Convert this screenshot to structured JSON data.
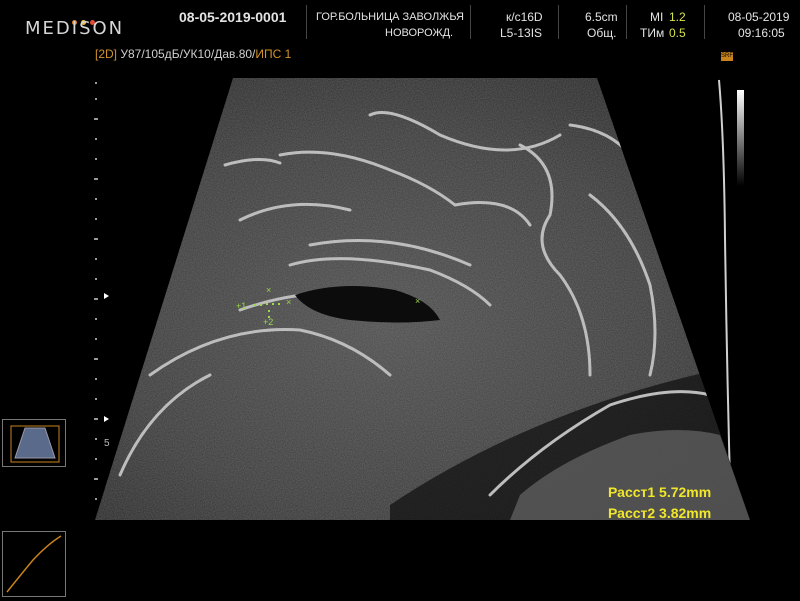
{
  "header": {
    "brand": "MEDISON",
    "brand_dot_colors": [
      "#e0852a",
      "#e8c23a",
      "#e04a3a"
    ],
    "patient_id": "08-05-2019-0001",
    "hospital": "ГОР.БОЛЬНИЦА ЗАВОЛЖЬЯ",
    "department": "НОВОРОЖД.",
    "probe_preset": "к/с16D",
    "probe": "L5-13IS",
    "depth": "6.5cm",
    "preset_mode": "Общ.",
    "mi_label": "MI",
    "mi_value": "1.2",
    "tim_label": "ТИм",
    "tim_value": "0.5",
    "date": "08-05-2019",
    "time": "09:16:05"
  },
  "modeline": {
    "mode": "[2D]",
    "params": "У87/105дБ/УК10/Дав.80/",
    "ips": "ИПС 1"
  },
  "scale": {
    "depth_tick_label": "5"
  },
  "badge": {
    "srf": "SRF"
  },
  "measurements": [
    {
      "label": "Расст1",
      "value": "5.72mm"
    },
    {
      "label": "Расст2",
      "value": "3.82mm"
    }
  ],
  "caliper_marks": {
    "m1": "+1",
    "m2": "+2",
    "x": "×"
  },
  "colors": {
    "accent_orange": "#c8831c",
    "measure_yellow": "#f0e62a",
    "caliper_green": "#9bd84a"
  }
}
